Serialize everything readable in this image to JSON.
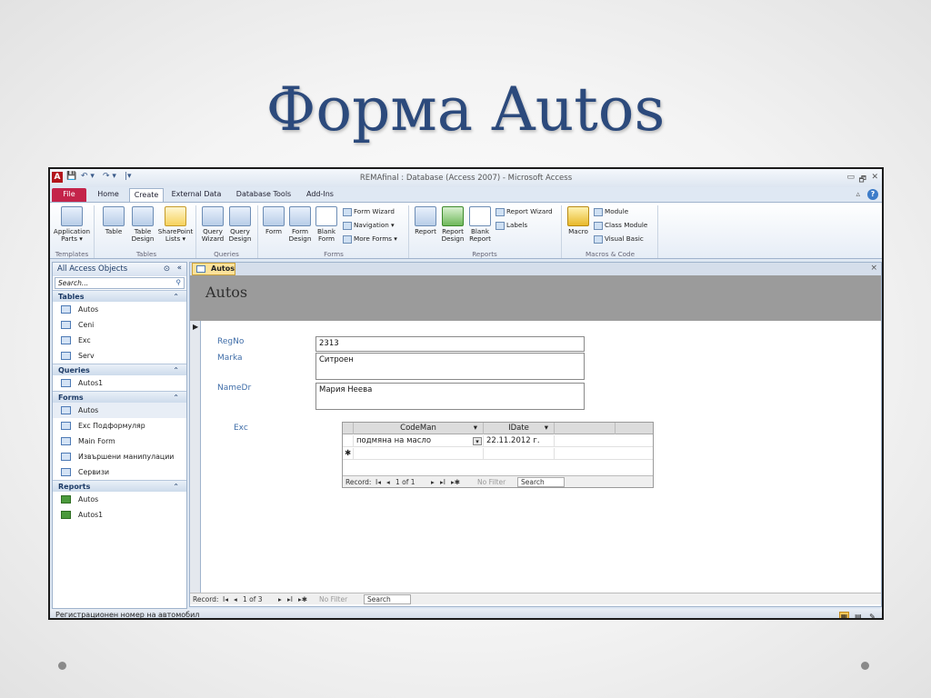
{
  "slide": {
    "title": "Форма Autos"
  },
  "window": {
    "app_icon_letter": "A",
    "quick_access": [
      "💾",
      "↶ ▾",
      "↷ ▾",
      "|▾"
    ],
    "title": "REMAfinal : Database (Access 2007) - Microsoft Access",
    "controls": {
      "minimize": "▭",
      "restore": "🗗",
      "close": "✕"
    },
    "help": "?",
    "collapse": "▵"
  },
  "tabs": [
    "File",
    "Home",
    "Create",
    "External Data",
    "Database Tools",
    "Add-Ins"
  ],
  "ribbon": {
    "templates": {
      "group": "Templates",
      "application_parts": "Application\nParts ▾"
    },
    "tables": {
      "group": "Tables",
      "table": "Table",
      "table_design": "Table\nDesign",
      "sharepoint": "SharePoint\nLists ▾"
    },
    "queries": {
      "group": "Queries",
      "wizard": "Query\nWizard",
      "design": "Query\nDesign"
    },
    "forms": {
      "group": "Forms",
      "form": "Form",
      "form_design": "Form\nDesign",
      "blank_form": "Blank\nForm",
      "form_wizard": "Form Wizard",
      "navigation": "Navigation ▾",
      "more_forms": "More Forms ▾"
    },
    "reports": {
      "group": "Reports",
      "report": "Report",
      "report_design": "Report\nDesign",
      "blank_report": "Blank\nReport",
      "report_wizard": "Report Wizard",
      "labels": "Labels"
    },
    "macros": {
      "group": "Macros & Code",
      "macro": "Macro",
      "module": "Module",
      "class_module": "Class Module",
      "visual_basic": "Visual Basic"
    }
  },
  "nav": {
    "header": "All Access Objects",
    "search_placeholder": "Search...",
    "collapse_glyph": "«",
    "dropdown_glyph": "⊙",
    "search_icon": "⚲",
    "sections": {
      "tables": {
        "label": "Tables",
        "items": [
          "Autos",
          "Ceni",
          "Exc",
          "Serv"
        ]
      },
      "queries": {
        "label": "Queries",
        "items": [
          "Autos1"
        ]
      },
      "forms": {
        "label": "Forms",
        "items": [
          "Autos",
          "Exc Подформуляр",
          "Main Form",
          "Извършени манипулации",
          "Сервизи"
        ]
      },
      "reports": {
        "label": "Reports",
        "items": [
          "Autos",
          "Autos1"
        ]
      }
    },
    "chevron": "⌃"
  },
  "document": {
    "tab_label": "Autos",
    "close": "×",
    "form_title": "Autos",
    "record_selector": "▶",
    "fields": {
      "regno": {
        "label": "RegNo",
        "value": "2313"
      },
      "marka": {
        "label": "Marka",
        "value": "Ситроен"
      },
      "namedr": {
        "label": "NameDr",
        "value": "Мария Неева"
      },
      "exc": {
        "label": "Exc"
      }
    },
    "subform": {
      "columns": [
        "CodeMan",
        "IDate"
      ],
      "sort_glyph": "▾",
      "rows": [
        {
          "codeman": "подмяна на масло",
          "idate": "22.11.2012 г."
        }
      ],
      "new_row_glyph": "✱",
      "combo_glyph": "▾",
      "nav": {
        "label": "Record:",
        "first": "I◂",
        "prev": "◂",
        "position": "1 of 1",
        "next": "▸",
        "last": "▸I",
        "new": "▸✱",
        "filter": "No Filter",
        "search": "Search"
      }
    },
    "main_nav": {
      "label": "Record:",
      "first": "I◂",
      "prev": "◂",
      "position": "1 of 3",
      "next": "▸",
      "last": "▸I",
      "new": "▸✱",
      "filter": "No Filter",
      "search": "Search"
    }
  },
  "status": {
    "text": "Регистрационен номер на автомобил",
    "views": [
      "▦",
      "▤",
      "✎"
    ]
  }
}
